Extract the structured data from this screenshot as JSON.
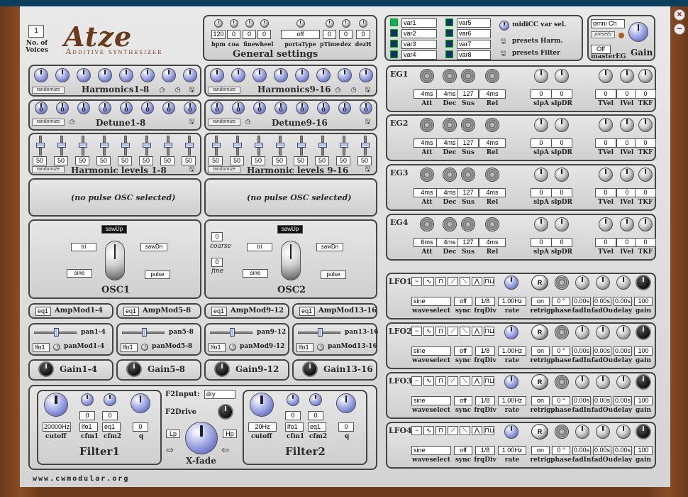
{
  "app": {
    "title": "Atze",
    "subtitle": "Additive synthesizer",
    "url": "www.cwmodular.org",
    "voices_value": "1",
    "voices_label": "No. of Voices"
  },
  "general": {
    "title": "General settings",
    "labels": [
      "bpm",
      "coa",
      "fine",
      "wheel",
      "portaType",
      "pTime",
      "dez",
      "dezH"
    ],
    "values": [
      "120",
      "0",
      "0",
      "0",
      "off",
      "0",
      "0",
      "0"
    ]
  },
  "vars": {
    "items": [
      "var1",
      "var2",
      "var3",
      "var4",
      "var5",
      "var6",
      "var7",
      "var8"
    ],
    "midicc_label": "midiCC var sel.",
    "presets_harm": "presets Harm.",
    "presets_filter": "presets Filter"
  },
  "master": {
    "channel": "omni Ch",
    "presets": "presets",
    "eg": "Off",
    "eg_label": "masterEG",
    "gain_label": "Gain"
  },
  "harmonics": [
    {
      "title": "Harmonics1-8",
      "randomize": "randomize"
    },
    {
      "title": "Harmonics9-16",
      "randomize": "randomize"
    }
  ],
  "detune": [
    {
      "title": "Detune1-8",
      "randomize": "randomize",
      "values": [
        "0",
        "0",
        "0",
        "0",
        "0",
        "0",
        "0",
        "0"
      ]
    },
    {
      "title": "Detune9-16",
      "randomize": "randomize",
      "values": [
        "0",
        "0",
        "0",
        "0",
        "0",
        "0",
        "0",
        "0"
      ]
    }
  ],
  "levels": [
    {
      "title": "Harmonic levels 1-8",
      "randomize": "randomize",
      "values": [
        "50",
        "50",
        "50",
        "50",
        "50",
        "50",
        "50",
        "50"
      ]
    },
    {
      "title": "Harmonic levels 9-16",
      "randomize": "randomize",
      "values": [
        "50",
        "50",
        "50",
        "50",
        "50",
        "50",
        "50",
        "50"
      ]
    }
  ],
  "pulse": [
    "(no pulse OSC selected)",
    "(no pulse OSC selected)"
  ],
  "osc": [
    {
      "title": "OSC1",
      "waves": {
        "sawUp": "sawUp",
        "tri": "tri",
        "sawDn": "sawDn",
        "sine": "sine",
        "pulse": "pulse"
      }
    },
    {
      "title": "OSC2",
      "coarse": "0",
      "coarse_label": "coarse",
      "fine": "0",
      "fine_label": "fine",
      "waves": {
        "sawUp": "sawUp",
        "tri": "tri",
        "sawDn": "sawDn",
        "sine": "sine",
        "pulse": "pulse"
      }
    }
  ],
  "ampmod": [
    {
      "src": "eq1",
      "label": "AmpMod1-4"
    },
    {
      "src": "eq1",
      "label": "AmpMod5-8"
    },
    {
      "src": "eq1",
      "label": "AmpMod9-12"
    },
    {
      "src": "eq1",
      "label": "AmpMod13-16"
    }
  ],
  "pan": [
    {
      "label": "pan1-4",
      "src": "lfo1",
      "mod": "panMod1-4"
    },
    {
      "label": "pan5-8",
      "src": "lfo1",
      "mod": "panMod5-8"
    },
    {
      "label": "pan9-12",
      "src": "lfo1",
      "mod": "panMod9-12"
    },
    {
      "label": "pan13-16",
      "src": "lfo1",
      "mod": "panMod13-16"
    }
  ],
  "gains": [
    "Gain1-4",
    "Gain5-8",
    "Gain9-12",
    "Gain13-16"
  ],
  "filters": [
    {
      "title": "Filter1",
      "cutoff": "20000Hz",
      "cutoff_label": "cutoff",
      "cfm1_val": "0",
      "cfm2_val": "0",
      "cfm1_src": "lfo1",
      "cfm2_src": "eq1",
      "q_val": "0",
      "cfm1": "cfm1",
      "cfm2": "cfm2",
      "q": "q"
    },
    {
      "title": "Filter2",
      "cutoff": "20Hz",
      "cutoff_label": "cutoff",
      "cfm1_val": "0",
      "cfm2_val": "0",
      "cfm1_src": "lfo1",
      "cfm2_src": "eq1",
      "q_val": "0",
      "cfm1": "cfm1",
      "cfm2": "cfm2",
      "q": "q"
    }
  ],
  "f2": {
    "input_label": "F2Input:",
    "input_val": "dry",
    "drive_label": "F2Drive",
    "xfade_label": "X-fade",
    "lp": "Lp",
    "hp": "Hp"
  },
  "eg": [
    {
      "title": "EG1",
      "vals": [
        "4ms",
        "4ms",
        "127",
        "4ms",
        "0",
        "0",
        "0",
        "0",
        "0"
      ]
    },
    {
      "title": "EG2",
      "vals": [
        "4ms",
        "4ms",
        "127",
        "4ms",
        "0",
        "0",
        "0",
        "0",
        "0"
      ]
    },
    {
      "title": "EG3",
      "vals": [
        "4ms",
        "4ms",
        "127",
        "4ms",
        "0",
        "0",
        "0",
        "0",
        "0"
      ]
    },
    {
      "title": "EG4",
      "vals": [
        "6ms",
        "4ms",
        "127",
        "4ms",
        "0",
        "0",
        "0",
        "0",
        "0"
      ]
    }
  ],
  "eg_labels": [
    "Att",
    "Dec",
    "Sus",
    "Rel",
    "slpA",
    "slpDR",
    "TVel",
    "lVel",
    "TKF"
  ],
  "lfo": [
    {
      "title": "LFO1",
      "vals": [
        "sine",
        "off",
        "1/8",
        "1.00Hz",
        "on",
        "0 °",
        "0.00s",
        "0.00s",
        "0.00s",
        "100"
      ]
    },
    {
      "title": "LFO2",
      "vals": [
        "sine",
        "off",
        "1/8",
        "1.00Hz",
        "on",
        "0 °",
        "0.00s",
        "0.00s",
        "0.00s",
        "100"
      ]
    },
    {
      "title": "LFO3",
      "vals": [
        "sine",
        "off",
        "1/8",
        "1.00Hz",
        "on",
        "0 °",
        "0.00s",
        "0.00s",
        "0.00s",
        "100"
      ]
    },
    {
      "title": "LFO4",
      "vals": [
        "sine",
        "off",
        "1/8",
        "1.00Hz",
        "on",
        "0 °",
        "0.00s",
        "0.00s",
        "0.00s",
        "100"
      ]
    }
  ],
  "lfo_labels": [
    "waveselect",
    "sync",
    "frqDiv",
    "rate",
    "retrig",
    "phase",
    "fadIn",
    "fadOu",
    "delay",
    "gain"
  ],
  "lfo_waves": [
    "~",
    "∿",
    "⊓",
    "⟋",
    "⟍",
    "⋀",
    "⊓⊔"
  ]
}
